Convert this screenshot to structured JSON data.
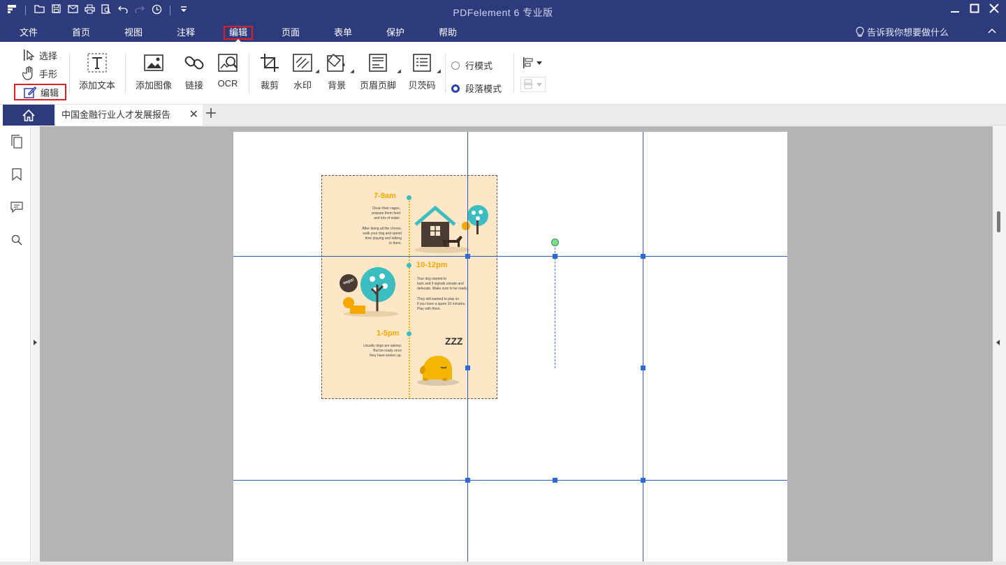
{
  "window": {
    "title": "PDFelement  6 专业版"
  },
  "menu": {
    "items": [
      "文件",
      "首页",
      "视图",
      "注释",
      "编辑",
      "页面",
      "表单",
      "保护",
      "帮助"
    ],
    "active": "编辑",
    "tell_me": "告诉我你想要做什么"
  },
  "ribbon": {
    "modes": {
      "select": "选择",
      "hand": "手形",
      "edit": "编辑"
    },
    "add_text": "添加文本",
    "add_image": "添加图像",
    "link": "链接",
    "ocr": "OCR",
    "crop": "裁剪",
    "watermark": "水印",
    "background": "背景",
    "header_footer": "页眉页脚",
    "bates": "贝茨码",
    "line_mode": "行模式",
    "paragraph_mode": "段落模式",
    "paragraph_mode_selected": true
  },
  "tabs": {
    "document": "中国金融行业人才发展报告"
  },
  "infographic": {
    "block1": {
      "time": "7-9am",
      "text1": "Clean their cages,\nprepare them food\nand lots of water.",
      "text2": "After doing all the chores,\nwalk your dog and spend\ntime playing and talking\nto them."
    },
    "block2": {
      "time": "10-12pm",
      "text1": "Your dog started to\nbark and it signals urinate and\ndefecate. Make sure to be ready!",
      "text2": "They still wanted to play so\nif you have a spare 10 minutes.\nPlay with them.",
      "bubble": "oops!"
    },
    "block3": {
      "time": "1-5pm",
      "text1": "Usually dogs are asleep.\nBut be ready once\nthey have woken up.",
      "zzz": "Z Z Z"
    }
  },
  "colors": {
    "titlebar": "#2d3a7c",
    "highlight_border": "#e02020",
    "guide_line": "#2b56c8",
    "infographic_bg": "#fde7c7",
    "accent_yellow": "#f5a800",
    "accent_teal": "#3bbdc2"
  }
}
